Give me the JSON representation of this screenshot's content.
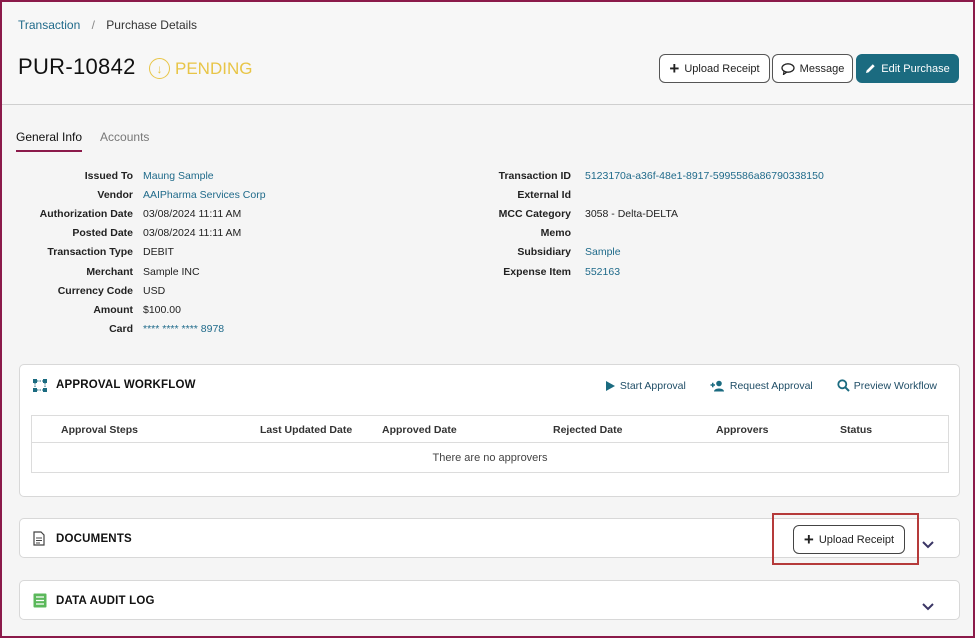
{
  "breadcrumb": {
    "parent": "Transaction",
    "current": "Purchase Details"
  },
  "header": {
    "id": "PUR-10842",
    "status": "PENDING",
    "status_icon": "arrow-down-circle-icon",
    "buttons": {
      "upload": "Upload Receipt",
      "message": "Message",
      "edit": "Edit Purchase"
    }
  },
  "tabs": [
    "General Info",
    "Accounts"
  ],
  "details_left": [
    {
      "label": "Issued To",
      "value": "Maung Sample",
      "link": true
    },
    {
      "label": "Vendor",
      "value": "AAIPharma Services Corp",
      "link": true
    },
    {
      "label": "Authorization Date",
      "value": "03/08/2024 11:11 AM",
      "link": false
    },
    {
      "label": "Posted Date",
      "value": "03/08/2024 11:11 AM",
      "link": false
    },
    {
      "label": "Transaction Type",
      "value": "DEBIT",
      "link": false
    },
    {
      "label": "Merchant",
      "value": "Sample INC",
      "link": false
    },
    {
      "label": "Currency Code",
      "value": "USD",
      "link": false
    },
    {
      "label": "Amount",
      "value": "$100.00",
      "link": false
    },
    {
      "label": "Card",
      "value": "**** **** **** 8978",
      "link": true
    }
  ],
  "details_right": [
    {
      "label": "Transaction ID",
      "value": "5123170a-a36f-48e1-8917-5995586a86790338150",
      "link": true
    },
    {
      "label": "External Id",
      "value": "",
      "link": false
    },
    {
      "label": "MCC Category",
      "value": "3058 - Delta-DELTA",
      "link": false
    },
    {
      "label": "Memo",
      "value": "",
      "link": false
    },
    {
      "label": "Subsidiary",
      "value": "Sample",
      "link": true
    },
    {
      "label": "Expense Item",
      "value": "552163",
      "link": true
    }
  ],
  "approval": {
    "title": "APPROVAL WORKFLOW",
    "actions": {
      "start": "Start Approval",
      "request": "Request Approval",
      "preview": "Preview Workflow"
    },
    "columns": [
      "Approval Steps",
      "Last Updated Date",
      "Approved Date",
      "Rejected Date",
      "Approvers",
      "Status"
    ],
    "empty": "There are no approvers"
  },
  "documents": {
    "title": "DOCUMENTS",
    "upload": "Upload Receipt"
  },
  "audit": {
    "title": "DATA AUDIT LOG"
  },
  "colors": {
    "accent": "#1b6b80",
    "link": "#1f6a8a",
    "pending": "#e8c547",
    "brand": "#8b1a4a",
    "highlight": "#b53a3a"
  }
}
